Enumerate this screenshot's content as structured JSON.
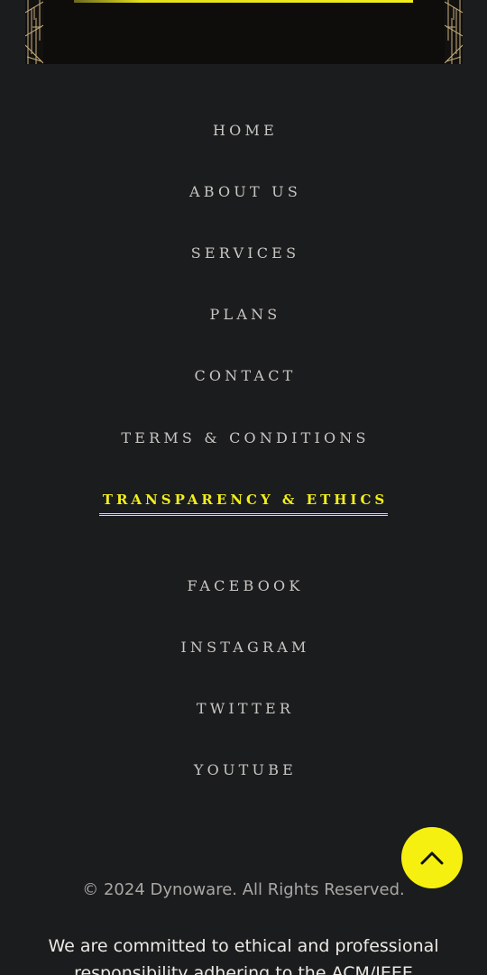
{
  "colors": {
    "background": "#1b1c1e",
    "accent": "#f2ee1c",
    "nav_text": "#c8c6c2"
  },
  "nav": {
    "items": [
      {
        "label": "HOME"
      },
      {
        "label": "ABOUT US"
      },
      {
        "label": "SERVICES"
      },
      {
        "label": "PLANS"
      },
      {
        "label": "CONTACT"
      },
      {
        "label": "TERMS & CONDITIONS"
      },
      {
        "label": "TRANSPARENCY & ETHICS",
        "active": true
      }
    ]
  },
  "social": {
    "items": [
      {
        "label": "FACEBOOK"
      },
      {
        "label": "INSTAGRAM"
      },
      {
        "label": "TWITTER"
      },
      {
        "label": "YOUTUBE"
      }
    ]
  },
  "back_to_top": {
    "icon": "chevron-up-icon"
  },
  "footer": {
    "copyright": "© 2024 Dynoware. All Rights Reserved.",
    "ethics_note": "We are committed to ethical and professional responsibility adhering to the ACM/IEEE Software"
  }
}
